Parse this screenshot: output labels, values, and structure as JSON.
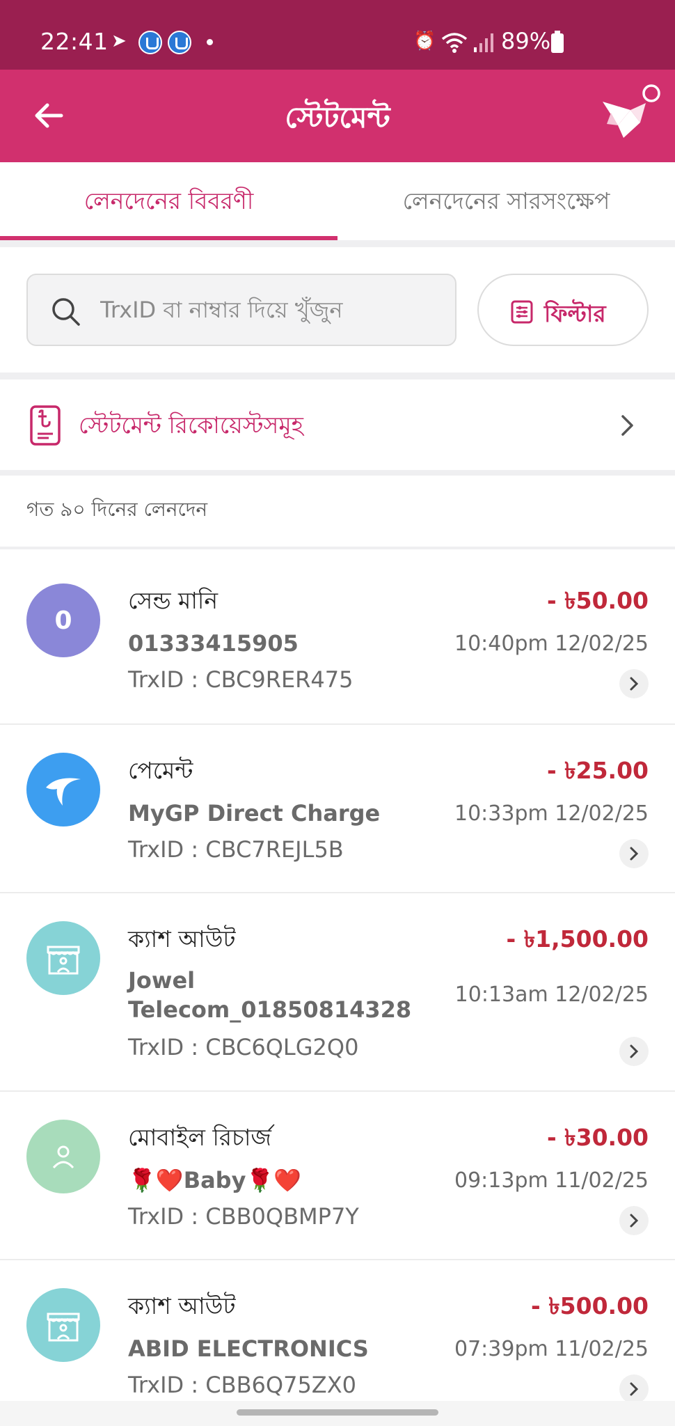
{
  "status_bar": {
    "time": "22:41",
    "battery": "89%"
  },
  "header": {
    "title": "স্টেটমেন্ট"
  },
  "tabs": [
    {
      "label": "লেনদেনের বিবরণী"
    },
    {
      "label": "লেনদেনের সারসংক্ষেপ"
    }
  ],
  "search": {
    "placeholder": "TrxID বা নাম্বার দিয়ে খুঁজুন"
  },
  "filter": {
    "label": "ফিল্টার"
  },
  "requests": {
    "label": "স্টেটমেন্ট রিকোয়েস্টসমূহ"
  },
  "period_label": "গত ৯০ দিনের লেনদেন",
  "transactions": [
    {
      "avatar_text": "0",
      "avatar_color": "#8a87d8",
      "type": "সেন্ড মানি",
      "party": "01333415905",
      "trx": "TrxID : CBC9RER475",
      "amount": "- ৳50.00",
      "datetime": "10:40pm 12/02/25"
    },
    {
      "avatar_icon": "gp-logo-icon",
      "avatar_color": "#3d9ef0",
      "type": "পেমেন্ট",
      "party": "MyGP Direct Charge",
      "trx": "TrxID : CBC7REJL5B",
      "amount": "- ৳25.00",
      "datetime": "10:33pm 12/02/25"
    },
    {
      "avatar_icon": "store-icon",
      "avatar_color": "#86d3d6",
      "type": "ক্যাশ আউট",
      "party": "Jowel Telecom_01850814328",
      "trx": "TrxID : CBC6QLG2Q0",
      "amount": "- ৳1,500.00",
      "datetime": "10:13am 12/02/25"
    },
    {
      "avatar_icon": "person-icon",
      "avatar_color": "#a8dcbb",
      "type": "মোবাইল রিচার্জ",
      "party": "🌹❤️Baby🌹❤️",
      "trx": "TrxID : CBB0QBMP7Y",
      "amount": "- ৳30.00",
      "datetime": "09:13pm 11/02/25"
    },
    {
      "avatar_icon": "store-icon",
      "avatar_color": "#86d3d6",
      "type": "ক্যাশ আউট",
      "party": "ABID ELECTRONICS",
      "trx": "TrxID : CBB6Q75ZX0",
      "amount": "- ৳500.00",
      "datetime": "07:39pm 11/02/25"
    }
  ]
}
